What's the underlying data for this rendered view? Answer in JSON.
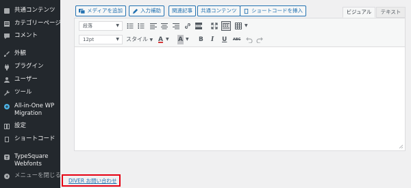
{
  "sidebar": {
    "items": [
      {
        "label": "共通コンテンツ",
        "icon": "common-content-icon"
      },
      {
        "label": "カテゴリーページ",
        "icon": "category-page-icon"
      },
      {
        "label": "コメント",
        "icon": "comment-icon"
      },
      {
        "label": "外観",
        "icon": "appearance-icon"
      },
      {
        "label": "プラグイン",
        "icon": "plugin-icon"
      },
      {
        "label": "ユーザー",
        "icon": "user-icon"
      },
      {
        "label": "ツール",
        "icon": "tools-icon"
      },
      {
        "label": "All-in-One WP Migration",
        "icon": "migration-icon"
      },
      {
        "label": "設定",
        "icon": "settings-icon"
      },
      {
        "label": "ショートコード",
        "icon": "shortcode-icon"
      },
      {
        "label": "TypeSquare Webfonts",
        "icon": "typesquare-icon"
      },
      {
        "label": "メニューを閉じる",
        "icon": "collapse-menu-icon"
      }
    ]
  },
  "editor": {
    "buttons": {
      "add_media": "メディアを追加",
      "input_assist": "入力補助",
      "related_posts": "関連記事",
      "common_content": "共通コンテンツ",
      "insert_shortcode": "ショートコードを挿入"
    },
    "tabs": {
      "visual": "ビジュアル",
      "text": "テキスト"
    },
    "toolbar": {
      "format_select": "段落",
      "font_size_select": "12pt",
      "style_label": "スタイル",
      "font_color_letter": "A",
      "highlight_letter": "A",
      "bold": "B",
      "italic": "I",
      "underline": "U",
      "strikethrough": "ABC"
    }
  },
  "footer": {
    "link": "DIVER お問い合わせ"
  },
  "colors": {
    "sidebar_bg": "#23282d",
    "accent": "#2271b1",
    "highlight_border": "#e60012"
  }
}
